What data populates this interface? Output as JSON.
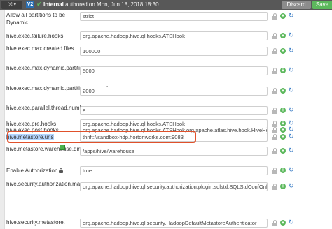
{
  "topbar": {
    "shuffle_icon_text": "⤨ ▾",
    "version_badge": "V2",
    "authored_prefix": "Internal",
    "authored_text": " authored on Mon, Jun 18, 2018 18:30",
    "discard_label": "Discard",
    "save_label": "Save"
  },
  "rows": [
    {
      "label": "Allow all partitions to be Dynamic",
      "value": "strict"
    },
    {
      "label": "hive.exec.failure.hooks",
      "value": "org.apache.hadoop.hive.ql.hooks.ATSHook"
    },
    {
      "label": "hive.exec.max.created.files",
      "value": "100000"
    },
    {
      "label": "hive.exec.max.dynamic.partitions",
      "value": "5000"
    },
    {
      "label": "hive.exec.max.dynamic.partitions.pernode",
      "value": "2000"
    },
    {
      "label": "hive.exec.parallel.thread.number",
      "value": "8"
    },
    {
      "label": "hive.exec.post.hooks",
      "value": "org.apache.hadoop.hive.ql.hooks.ATSHook,org.apache.atlas.hive.hook.HiveHook"
    },
    {
      "label": "hive.exec.pre.hooks",
      "value": "org.apache.hadoop.hive.ql.hooks.ATSHook"
    },
    {
      "label": "hive.metastore.uris",
      "value": "thrift://sandbox-hdp.hortonworks.com:9083"
    },
    {
      "label": "hive.metastore.warehouse.dir",
      "value": "/apps/hive/warehouse"
    },
    {
      "label": "Enable Authorization",
      "value": "true"
    },
    {
      "label": "hive.security.authorization.manager",
      "value": "org.apache.hadoop.hive.ql.security.authorization.plugin.sqlstd.SQLStdConfOnlyAuthorizerFactory"
    },
    {
      "label": "hive.security.metastore.",
      "value": "org.apache.hadoop.hive.ql.security.HadoopDefaultMetastoreAuthenticator"
    }
  ],
  "icons": {
    "lock": "lock-icon",
    "plus": "+",
    "refresh": "↻"
  },
  "colors": {
    "save": "#5cb85c",
    "highlight_box": "#e0512b",
    "selection": "#b4d5fe"
  }
}
